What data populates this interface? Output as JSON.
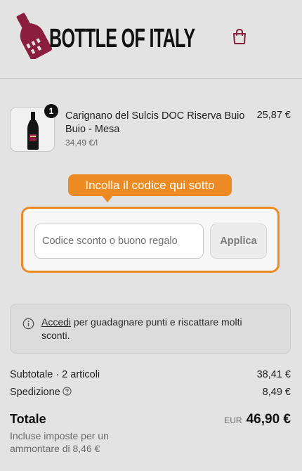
{
  "header": {
    "brand": "BOTTLE OF ITALY",
    "brand_color": "#8b1e3f"
  },
  "cart_item": {
    "quantity": "1",
    "name": "Carignano del Sulcis DOC Riserva Buio Buio - Mesa",
    "unit_price": "34,49 €/l",
    "price": "25,87 €"
  },
  "discount": {
    "callout": "Incolla il codice qui sotto",
    "placeholder": "Codice sconto o buono regalo",
    "apply_label": "Applica",
    "accent_color": "#ec8b23"
  },
  "loyalty": {
    "link_label": "Accedi",
    "text": " per guadagnare punti e riscattare molti sconti."
  },
  "summary": {
    "subtotal_label": "Subtotale · 2 articoli",
    "subtotal_value": "38,41 €",
    "shipping_label": "Spedizione",
    "shipping_value": "8,49 €",
    "total_label": "Totale",
    "tax_note": "Incluse imposte per un ammontare di 8,46 €",
    "currency": "EUR",
    "total_value": "46,90 €"
  }
}
